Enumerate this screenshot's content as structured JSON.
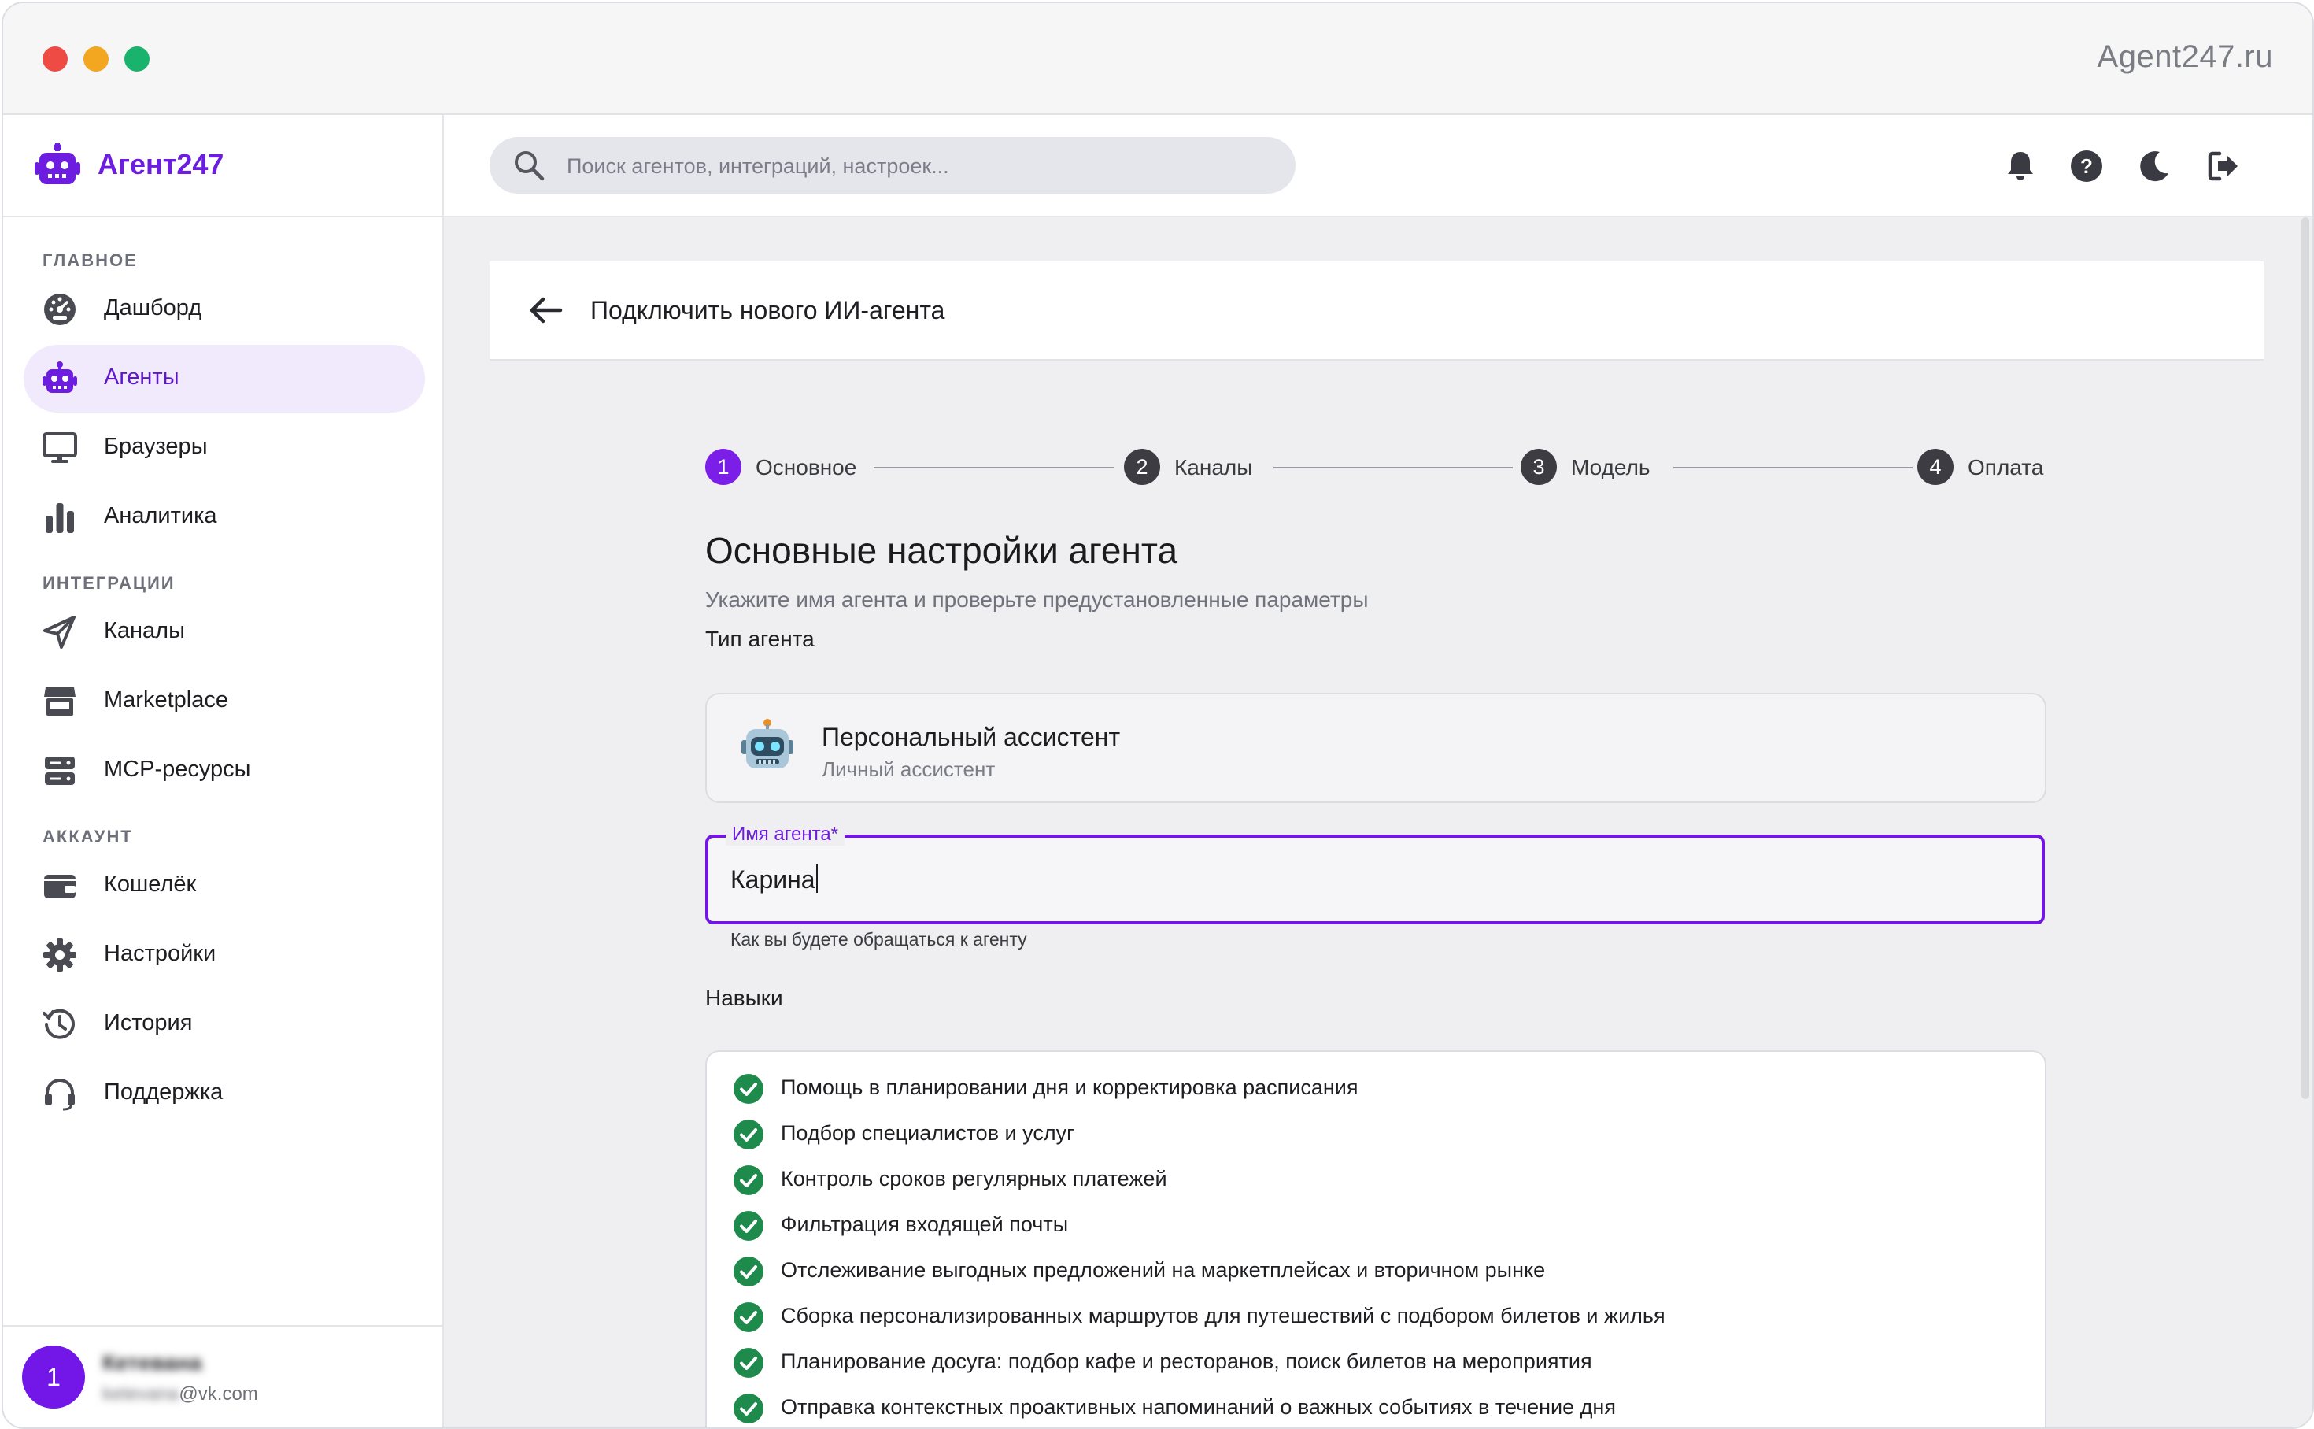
{
  "window": {
    "site_name": "Agent247.ru"
  },
  "brand": {
    "name": "Агент247",
    "accent_color": "#6c1de0"
  },
  "sidebar": {
    "sections": [
      {
        "label": "ГЛАВНОЕ",
        "items": [
          {
            "label": "Дашборд",
            "icon": "dashboard-icon"
          },
          {
            "label": "Агенты",
            "icon": "robot-icon",
            "active": true
          },
          {
            "label": "Браузеры",
            "icon": "monitor-icon"
          },
          {
            "label": "Аналитика",
            "icon": "bar-chart-icon"
          }
        ]
      },
      {
        "label": "ИНТЕГРАЦИИ",
        "items": [
          {
            "label": "Каналы",
            "icon": "send-icon"
          },
          {
            "label": "Marketplace",
            "icon": "store-icon"
          },
          {
            "label": "MCP-ресурсы",
            "icon": "server-icon"
          }
        ]
      },
      {
        "label": "АККАУНТ",
        "items": [
          {
            "label": "Кошелёк",
            "icon": "wallet-icon"
          },
          {
            "label": "Настройки",
            "icon": "gear-icon"
          },
          {
            "label": "История",
            "icon": "history-icon"
          },
          {
            "label": "Поддержка",
            "icon": "headset-icon"
          }
        ]
      }
    ],
    "user": {
      "avatar_initial": "1",
      "name_blurred": "Кетевана",
      "email_blurred": "ketevana",
      "email_domain": "vk.com"
    }
  },
  "topbar": {
    "search_placeholder": "Поиск агентов, интеграций, настроек...",
    "icons": [
      "bell-icon",
      "help-icon",
      "moon-icon",
      "logout-icon"
    ]
  },
  "page": {
    "header_title": "Подключить нового ИИ-агента",
    "stepper": [
      {
        "num": "1",
        "label": "Основное",
        "active": true
      },
      {
        "num": "2",
        "label": "Каналы"
      },
      {
        "num": "3",
        "label": "Модель"
      },
      {
        "num": "4",
        "label": "Оплата"
      }
    ],
    "form_title": "Основные настройки агента",
    "form_subtitle": "Укажите имя агента и проверьте предустановленные параметры",
    "agent_type_label": "Тип агента",
    "agent_type": {
      "name": "Персональный ассистент",
      "description": "Личный ассистент",
      "icon": "robot-emoji-icon"
    },
    "name_field": {
      "label": "Имя агента*",
      "value": "Карина",
      "help": "Как вы будете обращаться к агенту"
    },
    "skills_label": "Навыки",
    "skills": [
      "Помощь в планировании дня и корректировка расписания",
      "Подбор специалистов и услуг",
      "Контроль сроков регулярных платежей",
      "Фильтрация входящей почты",
      "Отслеживание выгодных предложений на маркетплейсах и вторичном рынке",
      "Сборка персонализированных маршрутов для путешествий с подбором билетов и жилья",
      "Планирование досуга: подбор кафе и ресторанов, поиск билетов на мероприятия",
      "Отправка контекстных проактивных напоминаний о важных событиях в течение дня"
    ],
    "check_color": "#1e8a4c"
  }
}
